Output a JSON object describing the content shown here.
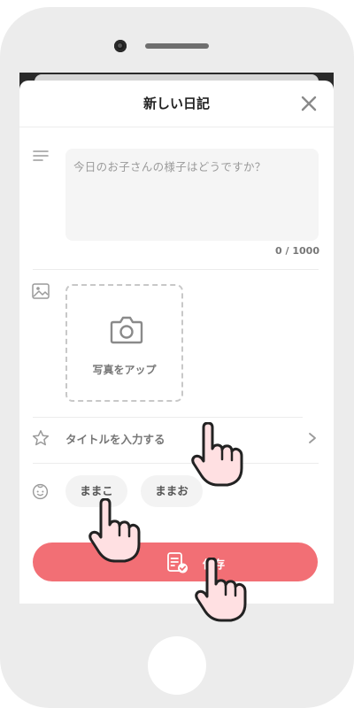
{
  "header": {
    "title": "新しい日記"
  },
  "memo": {
    "placeholder": "今日のお子さんの様子はどうですか？",
    "counter": "0 / 1000"
  },
  "photo": {
    "label": "写真をアップ"
  },
  "title_field": {
    "placeholder": "タイトルを入力する"
  },
  "children": [
    {
      "name": "ままこ"
    },
    {
      "name": "ままお"
    }
  ],
  "save": {
    "label": "保存"
  },
  "colors": {
    "accent": "#f26f75",
    "icon_gray": "#9a9a9a",
    "frame": "#ececec"
  },
  "icons": [
    "close-icon",
    "text-lines-icon",
    "image-icon",
    "camera-icon",
    "star-icon",
    "chevron-right-icon",
    "child-face-icon",
    "save-note-icon",
    "pointing-hand-icon"
  ]
}
